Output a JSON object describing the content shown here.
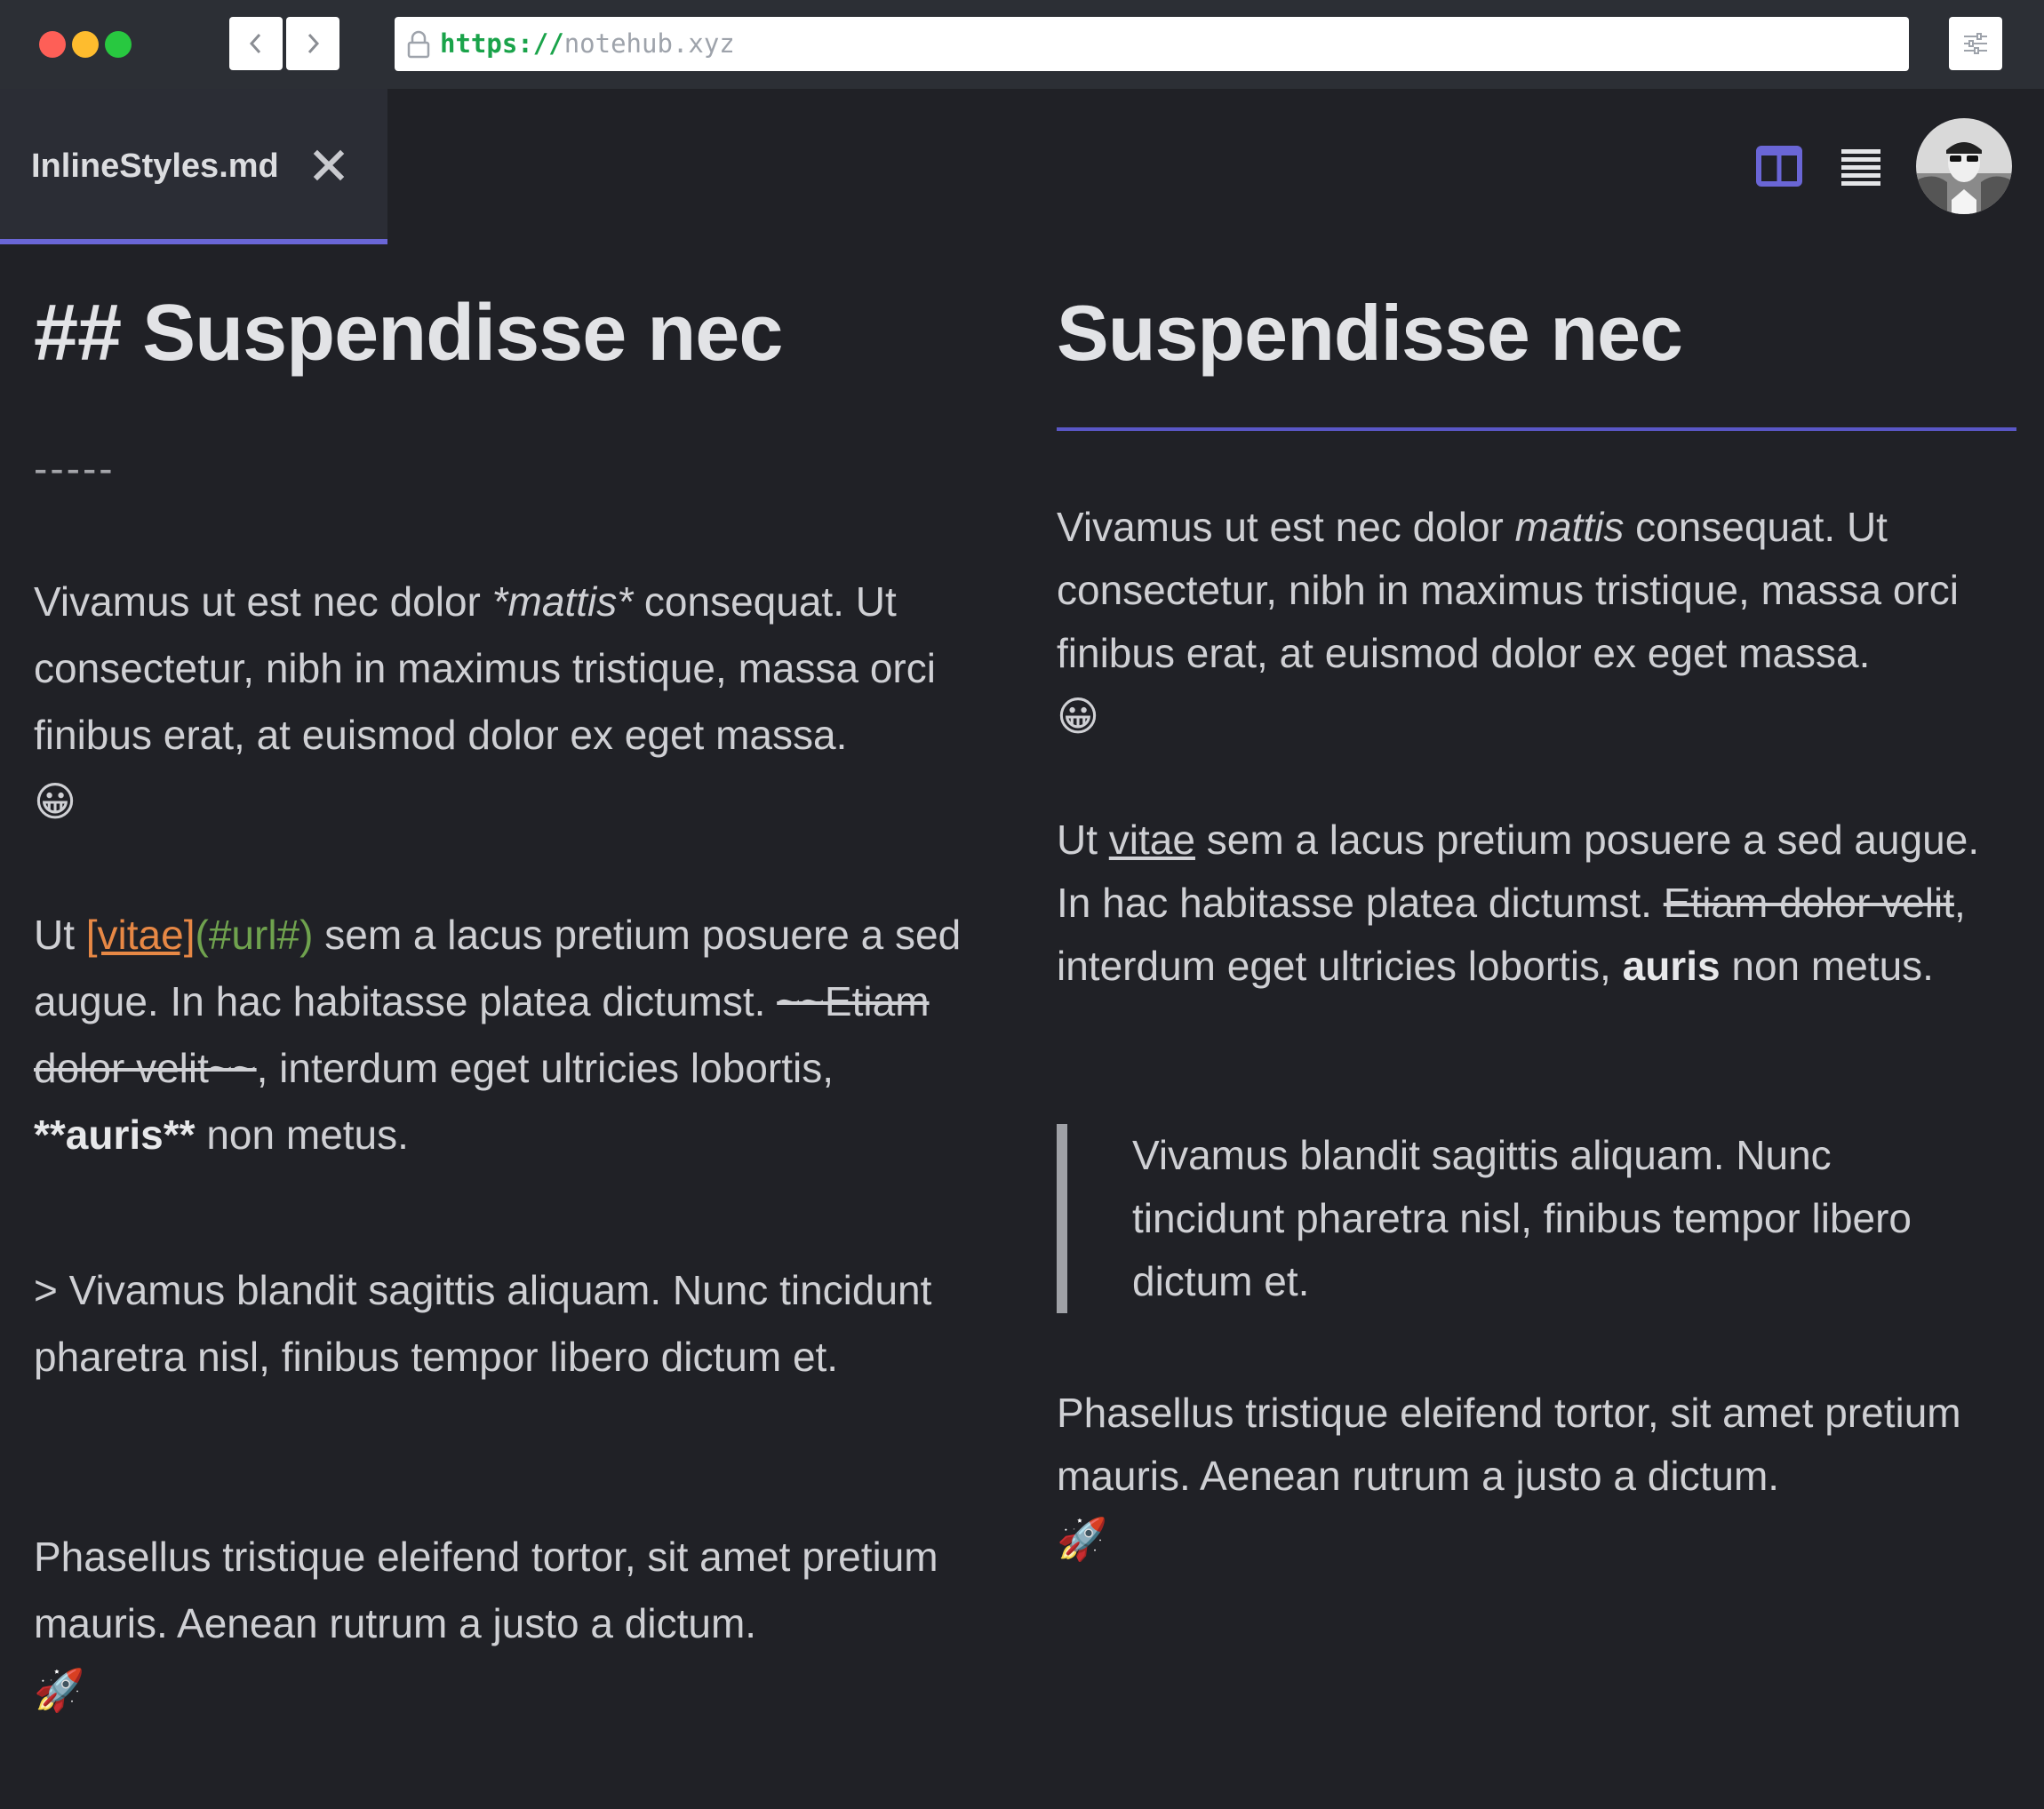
{
  "browser": {
    "url_scheme": "https://",
    "url_host": "notehub.xyz",
    "icons": {
      "back": "chevron-left-icon",
      "forward": "chevron-right-icon",
      "lock": "lock-icon",
      "settings": "sliders-icon"
    }
  },
  "tab": {
    "filename": "InlineStyles.md",
    "close_icon": "close-icon"
  },
  "toolbar": {
    "split_view_icon": "split-view-icon",
    "list_view_icon": "list-view-icon",
    "accent": "#6a66d6"
  },
  "editor": {
    "heading": "## Suspendisse nec",
    "rule": "-----",
    "p1": {
      "before": "Vivamus ut est nec dolor ",
      "italic": "*mattis*",
      "after": " consequat. Ut consectetur, nibh in maximus tristique, massa orci finibus erat, at euismod dolor ex eget massa.",
      "emoji": "😀"
    },
    "p2": {
      "before": "Ut ",
      "link": "[vitae]",
      "url": "(#url#)",
      "mid": " sem a lacus pretium posuere a sed augue. In hac habitasse platea dictumst. ",
      "strike": "~~Etiam dolor velit~~",
      "mid2": ", interdum eget ultricies lobortis, ",
      "bold": "**auris**",
      "after": " non metus."
    },
    "p3": "> Vivamus blandit sagittis aliquam. Nunc tincidunt pharetra nisl, finibus tempor libero dictum et.",
    "p4": {
      "text": "Phasellus tristique eleifend tortor, sit amet pretium mauris. Aenean rutrum a justo a dictum.",
      "emoji": "🚀"
    }
  },
  "preview": {
    "heading": "Suspendisse nec",
    "p1": {
      "before": "Vivamus ut est nec dolor ",
      "italic": "mattis",
      "after": " consequat. Ut consectetur, nibh in maximus tristique, massa orci finibus erat, at euismod dolor ex eget massa.",
      "emoji": "😀"
    },
    "p2": {
      "before": "Ut ",
      "link": "vitae",
      "mid": " sem a lacus pretium posuere a sed augue. In hac habitasse platea dictumst. ",
      "strike": "Etiam dolor velit",
      "mid2": ", interdum eget ultricies lobortis, ",
      "bold": "auris",
      "after": " non metus."
    },
    "quote": "Vivamus blandit sagittis aliquam. Nunc tincidunt pharetra nisl, finibus tempor libero dictum et.",
    "p4": {
      "text": "Phasellus tristique eleifend tortor, sit amet pretium mauris. Aenean rutrum a justo a dictum.",
      "emoji": "🚀"
    }
  }
}
